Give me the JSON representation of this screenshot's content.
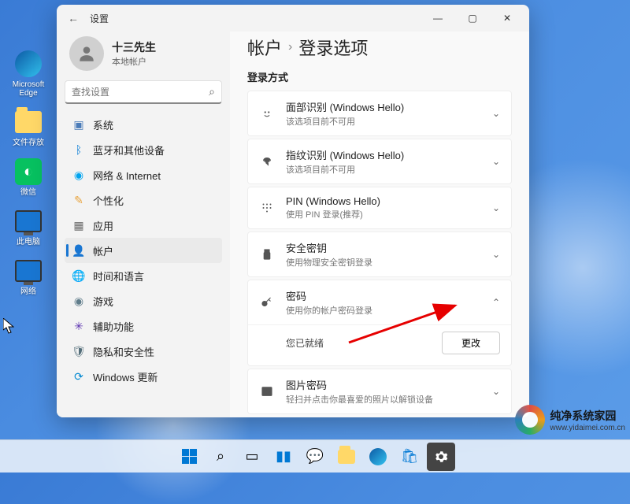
{
  "desktop_icons": {
    "edge": "Microsoft Edge",
    "folder": "文件存放",
    "wechat": "微信",
    "pc": "此电脑",
    "network": "网络"
  },
  "window": {
    "title": "设置",
    "controls": {
      "min": "—",
      "max": "▢",
      "close": "✕"
    },
    "back": "←"
  },
  "profile": {
    "name": "十三先生",
    "subtitle": "本地帐户"
  },
  "search": {
    "placeholder": "查找设置"
  },
  "nav": {
    "system": "系统",
    "bluetooth": "蓝牙和其他设备",
    "network": "网络 & Internet",
    "personalization": "个性化",
    "apps": "应用",
    "accounts": "帐户",
    "time": "时间和语言",
    "gaming": "游戏",
    "accessibility": "辅助功能",
    "privacy": "隐私和安全性",
    "update": "Windows 更新"
  },
  "breadcrumb": {
    "root": "帐户",
    "sep": "›",
    "page": "登录选项"
  },
  "section_title": "登录方式",
  "options": {
    "face": {
      "title": "面部识别 (Windows Hello)",
      "sub": "该选项目前不可用"
    },
    "fingerprint": {
      "title": "指纹识别 (Windows Hello)",
      "sub": "该选项目前不可用"
    },
    "pin": {
      "title": "PIN (Windows Hello)",
      "sub": "使用 PIN 登录(推荐)"
    },
    "key": {
      "title": "安全密钥",
      "sub": "使用物理安全密钥登录"
    },
    "password": {
      "title": "密码",
      "sub": "使用你的帐户密码登录",
      "status": "您已就绪",
      "change": "更改"
    },
    "picture": {
      "title": "图片密码",
      "sub": "轻扫并点击你最喜爱的照片以解锁设备"
    }
  },
  "watermark": {
    "title": "纯净系统家园",
    "url": "www.yidaimei.com.cn"
  },
  "nav_colors": {
    "system": "#4a7bb8",
    "bluetooth": "#0078d4",
    "network": "#00a4ef",
    "personalization": "#e8a33d",
    "apps": "#6b6b6b",
    "accounts": "#1976d2",
    "time": "#00897b",
    "gaming": "#607d8b",
    "accessibility": "#5e35b1",
    "privacy": "#546e7a",
    "update": "#0288d1"
  }
}
